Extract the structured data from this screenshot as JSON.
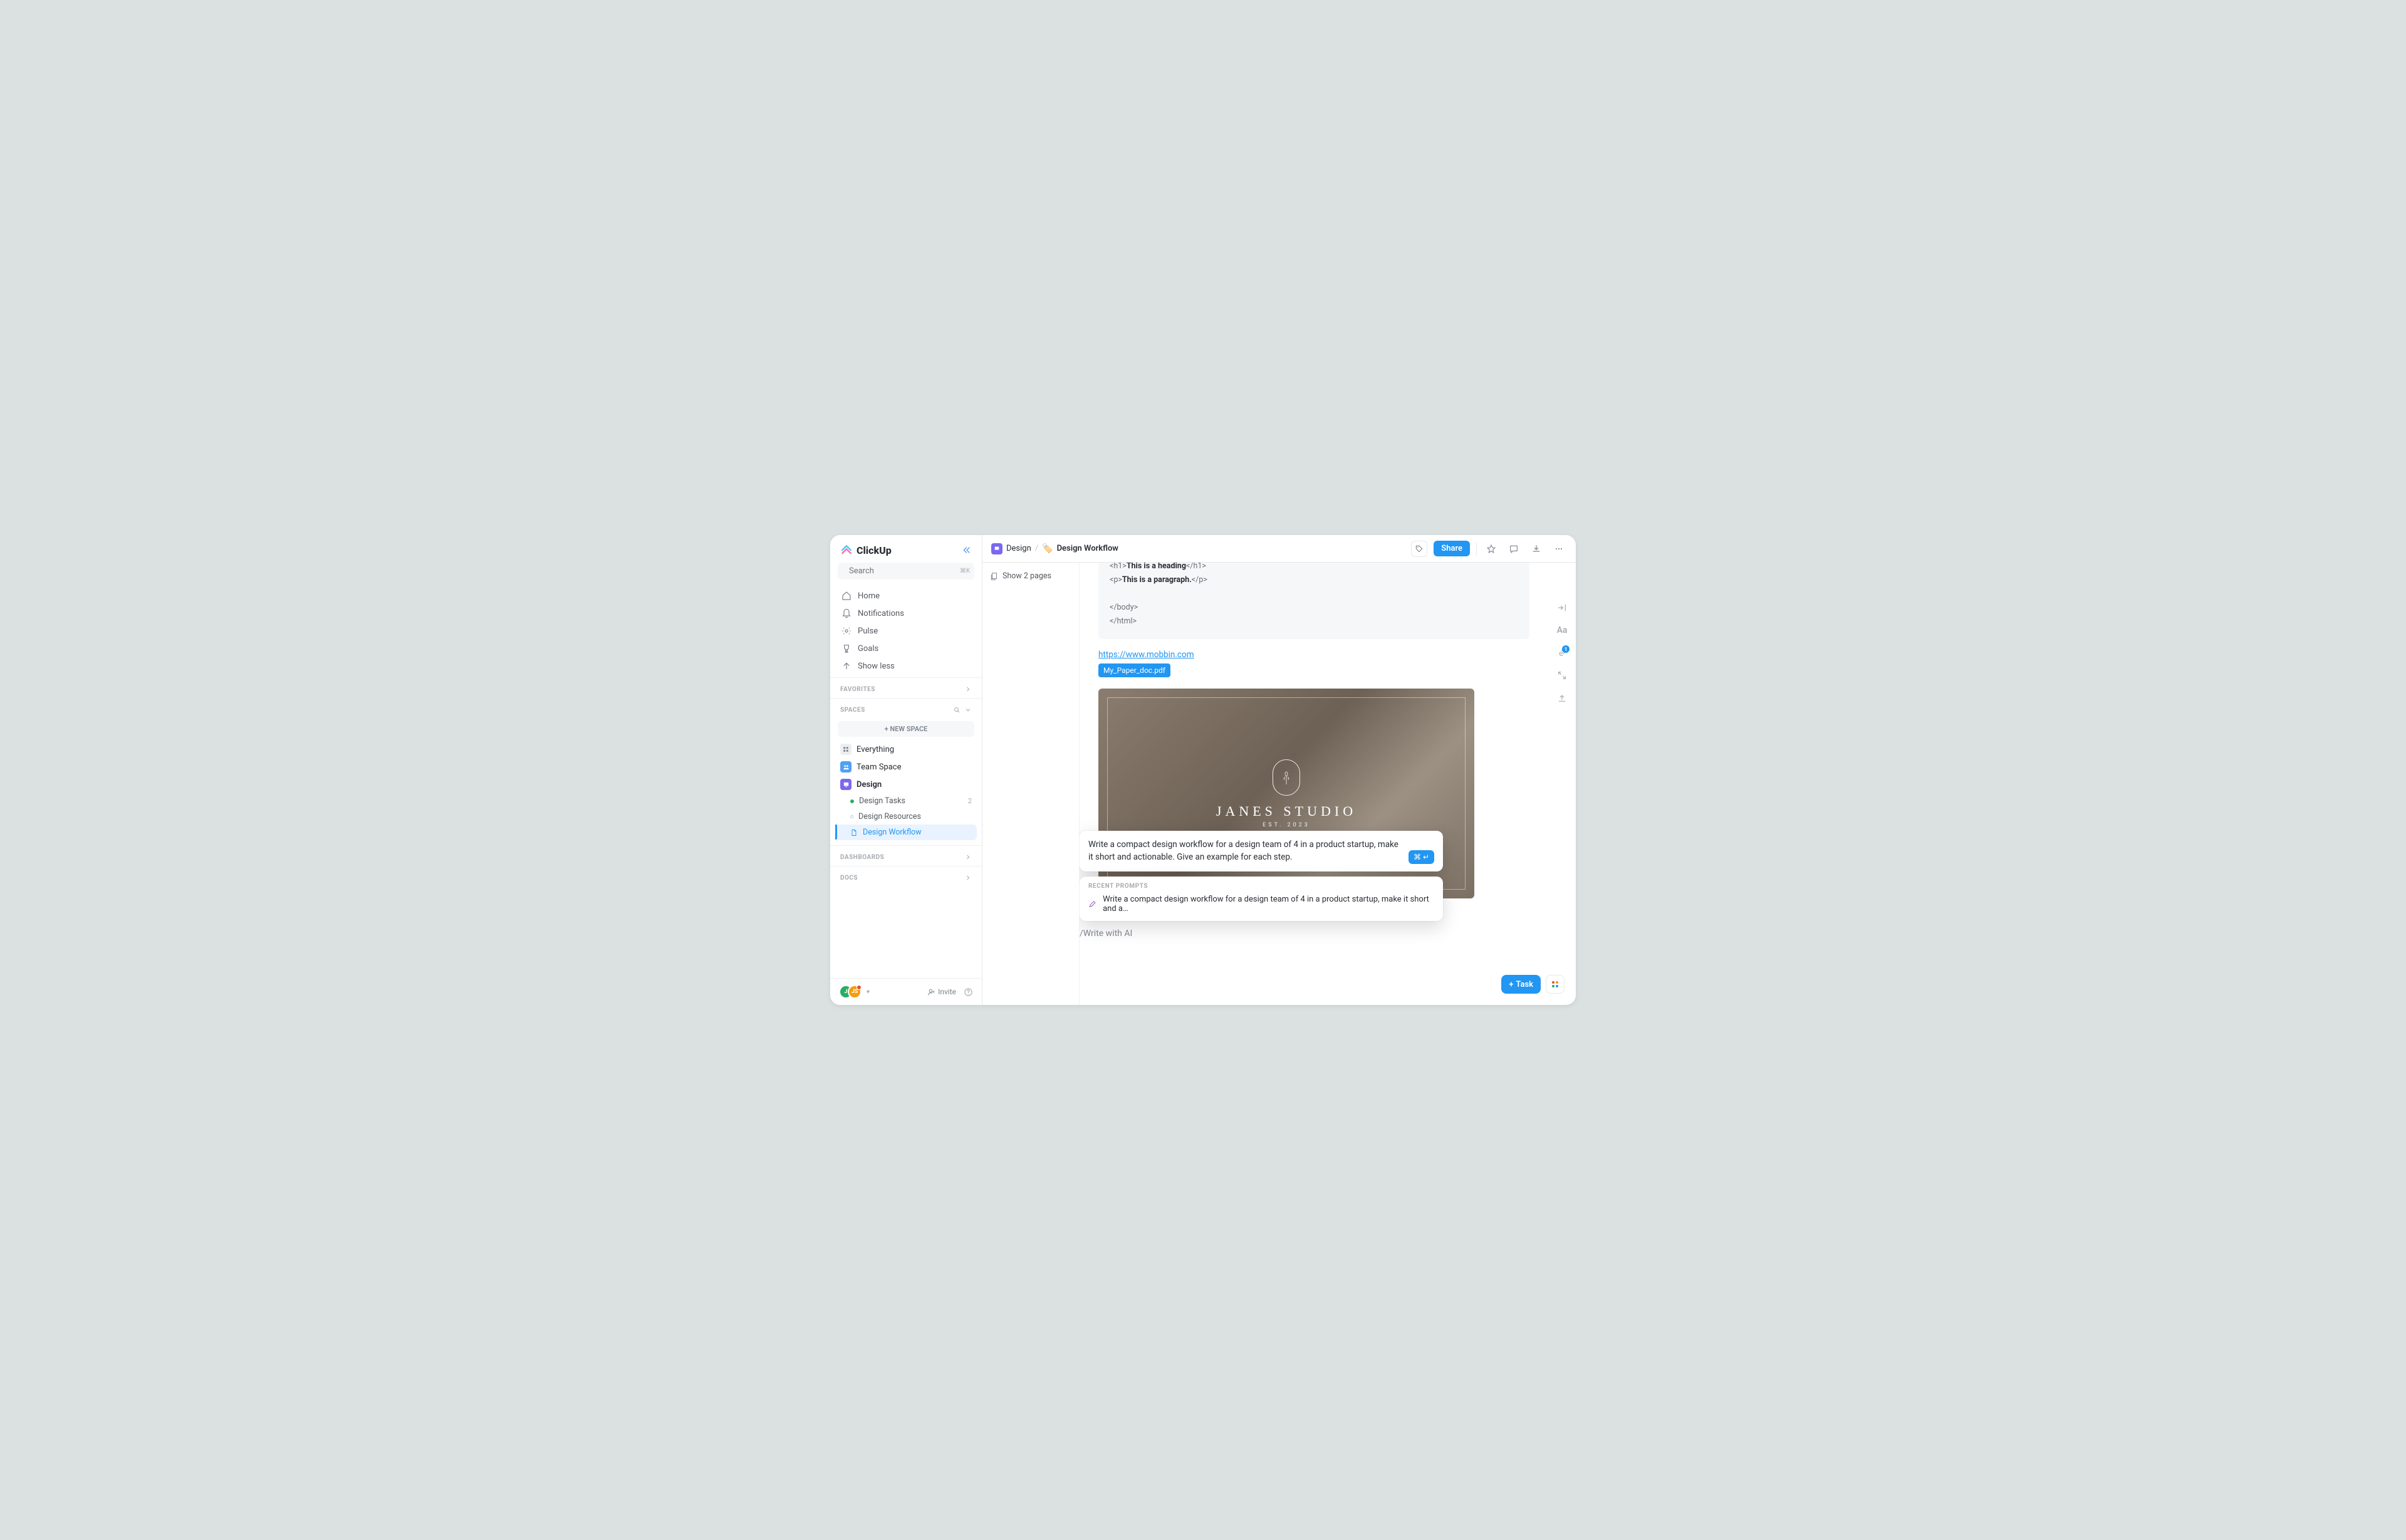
{
  "brand": {
    "name": "ClickUp"
  },
  "search": {
    "placeholder": "Search",
    "kbd": "⌘K"
  },
  "nav": {
    "home": "Home",
    "notifications": "Notifications",
    "pulse": "Pulse",
    "goals": "Goals",
    "show_less": "Show less"
  },
  "sections": {
    "favorites": "FAVORITES",
    "spaces": "SPACES",
    "dashboards": "DASHBOARDS",
    "docs": "DOCS",
    "new_space": "+ NEW SPACE"
  },
  "spaces": {
    "everything": "Everything",
    "team_space": "Team Space",
    "design": "Design",
    "design_tasks": {
      "label": "Design Tasks",
      "count": "2"
    },
    "design_resources": "Design Resources",
    "design_workflow": "Design Workflow"
  },
  "sidebar_footer": {
    "avatar1": "J",
    "avatar2": "JS",
    "invite": "Invite"
  },
  "breadcrumb": {
    "space": "Design",
    "doc": "Design Workflow"
  },
  "topbar": {
    "share": "Share"
  },
  "subheader": {
    "show_pages": "Show 2 pages"
  },
  "doc": {
    "code_lines": "<h1>This is a heading</h1>\n<p>This is a paragraph.</p>\n\n</body>\n</html>",
    "link_text": "https://www.mobbin.com",
    "link_href": "https://www.mobbin.com",
    "file_chip": "My_Paper_doc.pdf",
    "hero_title": "JANES STUDIO",
    "hero_sub": "EST. 2023",
    "slash_cmd": "/Write with AI"
  },
  "ai": {
    "input_text": "Write a compact design workflow for a design team of 4 in a product startup, make it short and actionable. Give an example for each step.",
    "submit_label": "⌘ ↵",
    "recent_head": "RECENT PROMPTS",
    "recent_item": "Write a compact design workflow for a design team of 4 in a product startup, make it short and a…"
  },
  "right_rail": {
    "badge": "1"
  },
  "fab": {
    "task": "Task"
  }
}
